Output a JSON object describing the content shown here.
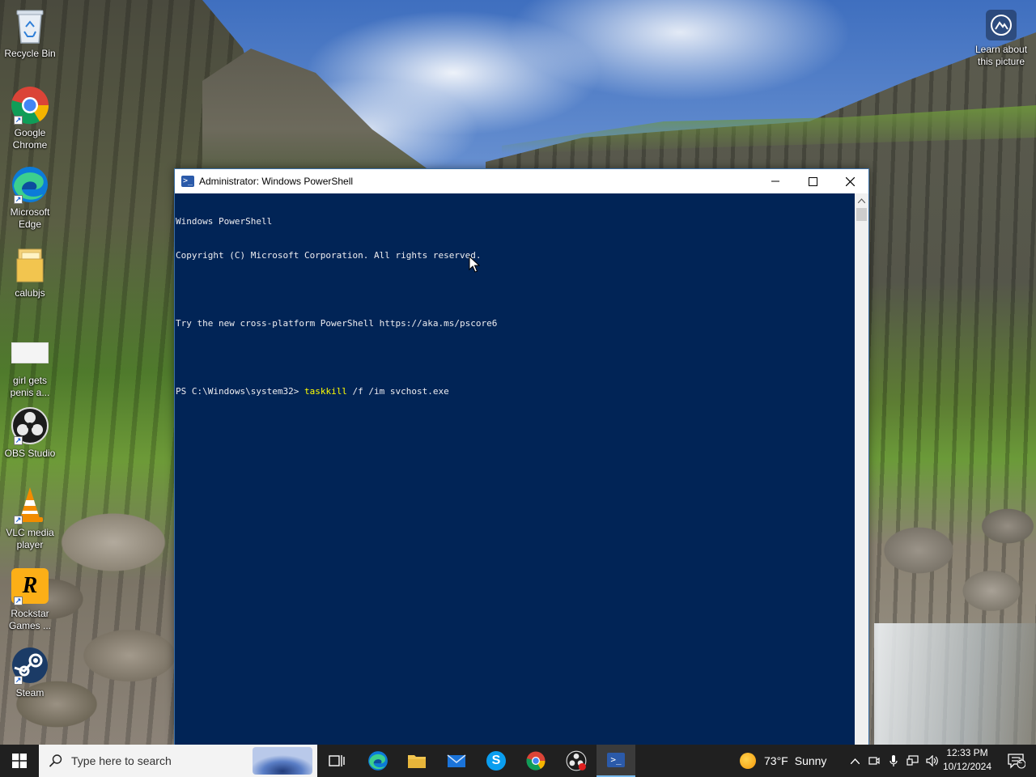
{
  "desktop": {
    "icons": [
      {
        "label": "Recycle Bin"
      },
      {
        "label": "Google\nChrome"
      },
      {
        "label": "Microsoft\nEdge"
      },
      {
        "label": "calubjs"
      },
      {
        "label": "girl gets\npenis a..."
      },
      {
        "label": "OBS Studio"
      },
      {
        "label": "VLC media\nplayer"
      },
      {
        "label": "Rockstar\nGames ..."
      },
      {
        "label": "Steam"
      }
    ],
    "learn_label": "Learn about\nthis picture"
  },
  "window": {
    "title": "Administrator: Windows PowerShell",
    "console": {
      "lines": [
        "Windows PowerShell",
        "Copyright (C) Microsoft Corporation. All rights reserved.",
        "",
        "Try the new cross-platform PowerShell https://aka.ms/pscore6",
        ""
      ],
      "prompt": "PS C:\\Windows\\system32> ",
      "command_name": "taskkill",
      "command_args": " /f /im svchost.exe"
    }
  },
  "taskbar": {
    "search_placeholder": "Type here to search",
    "weather_temp": "73°F",
    "weather_text": "Sunny",
    "time": "12:33 PM",
    "date": "10/12/2024",
    "notification_count": "2"
  },
  "colors": {
    "console_bg": "#012456",
    "console_text": "#eeedf0",
    "command_highlight": "#ffff00",
    "taskbar_bg": "#202020"
  }
}
